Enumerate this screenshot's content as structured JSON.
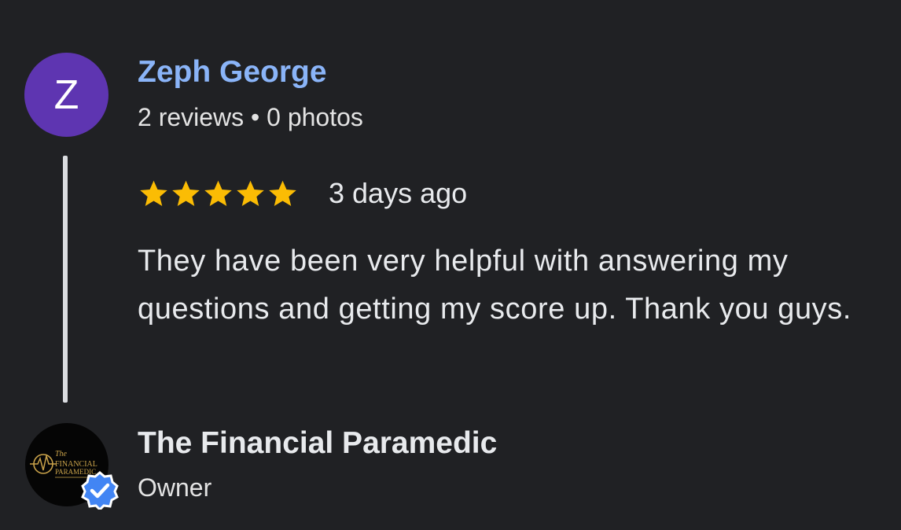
{
  "review": {
    "reviewer": {
      "initial": "Z",
      "name": "Zeph George",
      "meta": "2 reviews • 0 photos",
      "avatar_color": "#5e35b1",
      "name_color": "#8ab4f8"
    },
    "rating": {
      "stars": 5,
      "max_stars": 5,
      "star_color": "#fbbc04",
      "icon": "star-icon"
    },
    "time_ago": "3 days ago",
    "text": "They have been very helpful with answering my questions and getting my score up. Thank you guys."
  },
  "owner_response": {
    "name": "The Financial Paramedic",
    "role": "Owner",
    "logo_text": [
      "The",
      "FINANCIAL",
      "PARAMEDIC"
    ],
    "logo_color": "#c9a24a",
    "verified_icon": "verified-check-icon",
    "verified_color": "#4285f4"
  }
}
